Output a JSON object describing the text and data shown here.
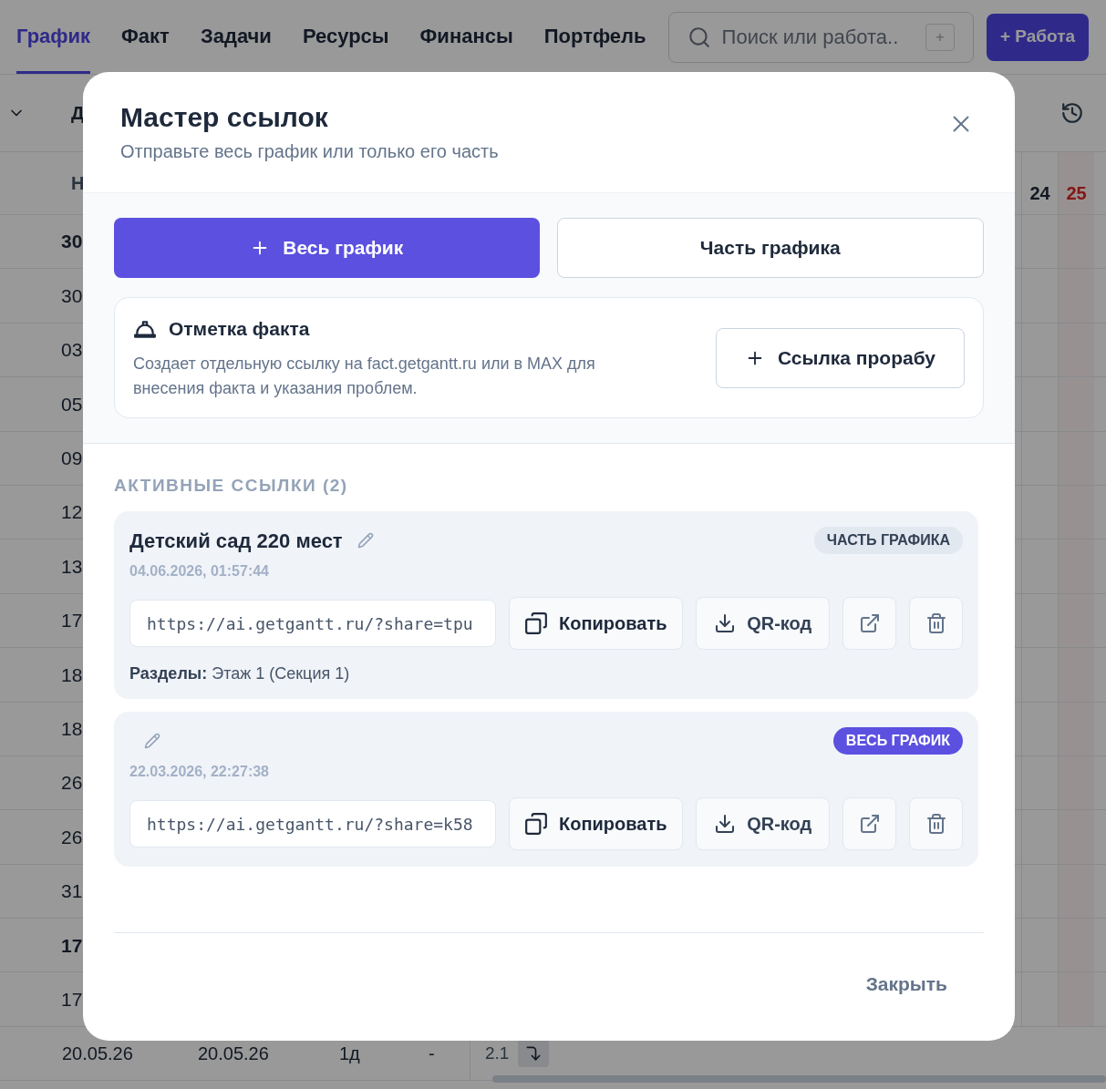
{
  "nav": {
    "tabs": [
      {
        "label": "График",
        "selected": true
      },
      {
        "label": "Факт",
        "selected": false
      },
      {
        "label": "Задачи",
        "selected": false
      },
      {
        "label": "Ресурсы",
        "selected": false
      },
      {
        "label": "Финансы",
        "selected": false
      },
      {
        "label": "Портфель",
        "selected": false
      }
    ],
    "search": {
      "placeholder": "Поиск или работа..",
      "shortcut": "+"
    },
    "add_button": "+ Работа"
  },
  "toolbar": {
    "column_1": "Д"
  },
  "grid": {
    "header_1": "Н",
    "days": [
      {
        "label": "24",
        "weekend": false
      },
      {
        "label": "25",
        "weekend": true
      }
    ],
    "rows": [
      {
        "text": "30",
        "bold": true
      },
      {
        "text": "30",
        "bold": false
      },
      {
        "text": "03",
        "bold": false
      },
      {
        "text": "05",
        "bold": false
      },
      {
        "text": "09",
        "bold": false
      },
      {
        "text": "12",
        "bold": false
      },
      {
        "text": "13",
        "bold": false
      },
      {
        "text": "17",
        "bold": false
      },
      {
        "text": "18",
        "bold": false
      },
      {
        "text": "18",
        "bold": false
      },
      {
        "text": "26",
        "bold": false
      },
      {
        "text": "26",
        "bold": false
      },
      {
        "text": "31",
        "bold": false
      },
      {
        "text": "17",
        "bold": true
      },
      {
        "text": "17",
        "bold": false
      }
    ],
    "last_row": {
      "cells": [
        "20.05.26",
        "20.05.26",
        "1д",
        "-",
        "2.1"
      ]
    }
  },
  "dialog": {
    "title": "Мастер ссылок",
    "subtitle": "Отправьте весь график или только его часть",
    "scope_buttons": [
      {
        "label": "Весь график",
        "selected": true
      },
      {
        "label": "Часть графика",
        "selected": false
      }
    ],
    "fact": {
      "title": "Отметка факта",
      "description": "Создает отдельную ссылку на fact.getgantt.ru или в MAX для внесения факта и указания проблем.",
      "button": "Ссылка прорабу"
    },
    "active_heading": "АКТИВНЫЕ ССЫЛКИ (2)",
    "links": [
      {
        "name": "Детский сад 220 мест",
        "kind": "part",
        "badge": "ЧАСТЬ ГРАФИКА",
        "date": "04.06.2026, 01:57:44",
        "url": "https://ai.getgantt.ru/?share=tpu",
        "copy": "Копировать",
        "qr": "QR-код",
        "sections": "**Разделы:** Этаж 1 (Секция 1)"
      },
      {
        "kind": "whole",
        "badge": "ВЕСЬ ГРАФИК",
        "date": "22.03.2026, 22:27:38",
        "url": "https://ai.getgantt.ru/?share=k58",
        "copy": "Копировать",
        "qr": "QR-код"
      }
    ],
    "close_button": "Закрыть"
  }
}
